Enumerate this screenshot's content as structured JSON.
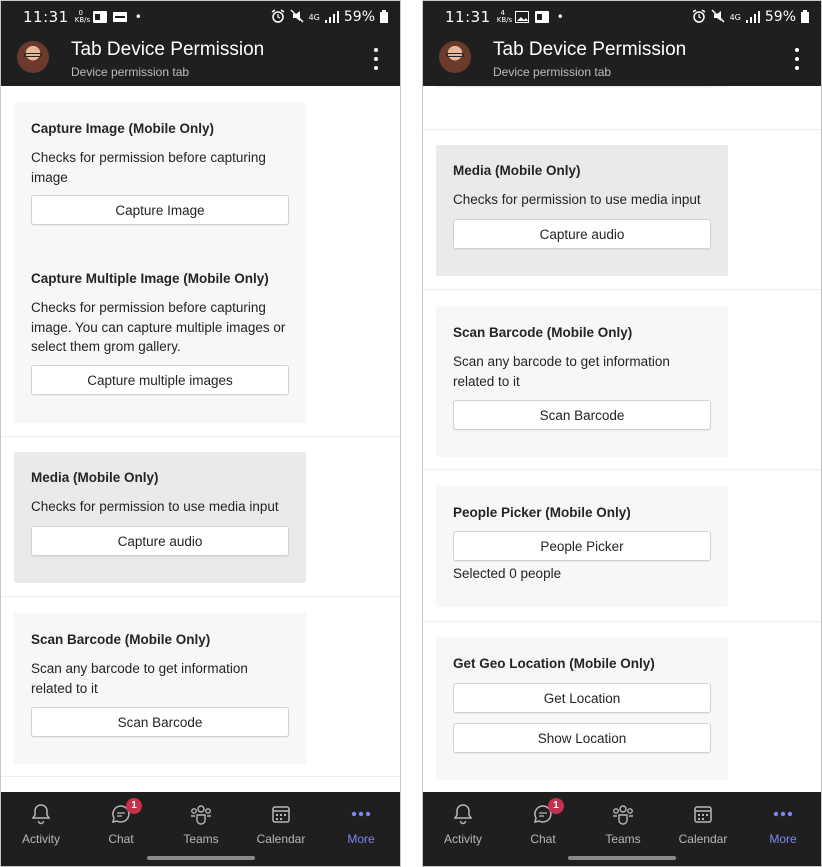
{
  "status": {
    "left_time": "11:31",
    "left_speed": [
      "0",
      "KB/s"
    ],
    "right_time": "11:31",
    "right_speed": [
      "4",
      "KB/s"
    ],
    "network": "4G",
    "battery": "59%"
  },
  "app": {
    "title": "Tab Device Permission",
    "subtitle": "Device permission tab"
  },
  "left_cards": {
    "capture_image": {
      "title": "Capture Image (Mobile Only)",
      "desc_1": "Checks for permission before capturing",
      "desc_2": "image",
      "button": "Capture Image"
    },
    "capture_multiple": {
      "title": "Capture Multiple Image (Mobile Only)",
      "desc_1": "Checks for permission before capturing",
      "desc_2": "image. You can capture multiple images or",
      "desc_3": "select them grom gallery.",
      "button": "Capture multiple images"
    },
    "media": {
      "title": "Media (Mobile Only)",
      "desc": "Checks for permission to use media input",
      "button": "Capture audio"
    },
    "scan_barcode": {
      "title": "Scan Barcode (Mobile Only)",
      "desc_1": "Scan any barcode to get information",
      "desc_2": "related to it",
      "button": "Scan Barcode"
    }
  },
  "right_cards": {
    "media": {
      "title": "Media (Mobile Only)",
      "desc": "Checks for permission to use media input",
      "button": "Capture audio"
    },
    "scan_barcode": {
      "title": "Scan Barcode (Mobile Only)",
      "desc_1": "Scan any barcode to get information",
      "desc_2": "related to it",
      "button": "Scan Barcode"
    },
    "people_picker": {
      "title": "People Picker (Mobile Only)",
      "button": "People Picker",
      "note": "Selected 0 people"
    },
    "geo_location": {
      "title": "Get Geo Location (Mobile Only)",
      "button_get": "Get Location",
      "button_show": "Show Location"
    }
  },
  "nav": {
    "activity": "Activity",
    "chat": "Chat",
    "chat_badge": "1",
    "teams": "Teams",
    "calendar": "Calendar",
    "more": "More",
    "active_color": "#7f85f5"
  }
}
